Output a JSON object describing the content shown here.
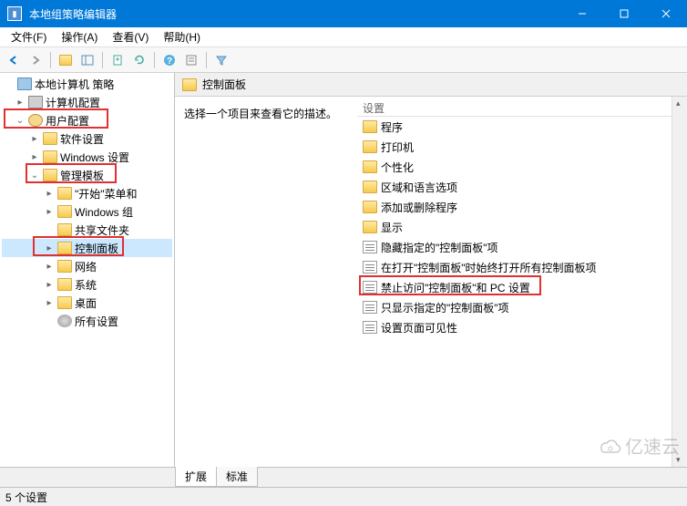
{
  "window": {
    "title": "本地组策略编辑器"
  },
  "menubar": {
    "file": "文件(F)",
    "action": "操作(A)",
    "view": "查看(V)",
    "help": "帮助(H)"
  },
  "tree": {
    "root": "本地计算机 策略",
    "computer_config": "计算机配置",
    "user_config": "用户配置",
    "software": "软件设置",
    "windows_settings": "Windows 设置",
    "admin_templates": "管理模板",
    "start_menu": "\"开始\"菜单和",
    "windows_comp": "Windows 组",
    "shared_folders": "共享文件夹",
    "control_panel": "控制面板",
    "network": "网络",
    "system": "系统",
    "desktop": "桌面",
    "all_settings": "所有设置"
  },
  "content": {
    "header": "控制面板",
    "desc_prompt": "选择一个项目来查看它的描述。",
    "settings_header": "设置"
  },
  "settings_items": [
    {
      "name": "程序",
      "type": "folder"
    },
    {
      "name": "打印机",
      "type": "folder"
    },
    {
      "name": "个性化",
      "type": "folder"
    },
    {
      "name": "区域和语言选项",
      "type": "folder"
    },
    {
      "name": "添加或删除程序",
      "type": "folder"
    },
    {
      "name": "显示",
      "type": "folder"
    },
    {
      "name": "隐藏指定的\"控制面板\"项",
      "type": "setting"
    },
    {
      "name": "在打开\"控制面板\"时始终打开所有控制面板项",
      "type": "setting"
    },
    {
      "name": "禁止访问\"控制面板\"和 PC 设置",
      "type": "setting"
    },
    {
      "name": "只显示指定的\"控制面板\"项",
      "type": "setting"
    },
    {
      "name": "设置页面可见性",
      "type": "setting"
    }
  ],
  "tabs": {
    "extended": "扩展",
    "standard": "标准"
  },
  "statusbar": {
    "count": "5 个设置"
  },
  "watermark": "亿速云"
}
